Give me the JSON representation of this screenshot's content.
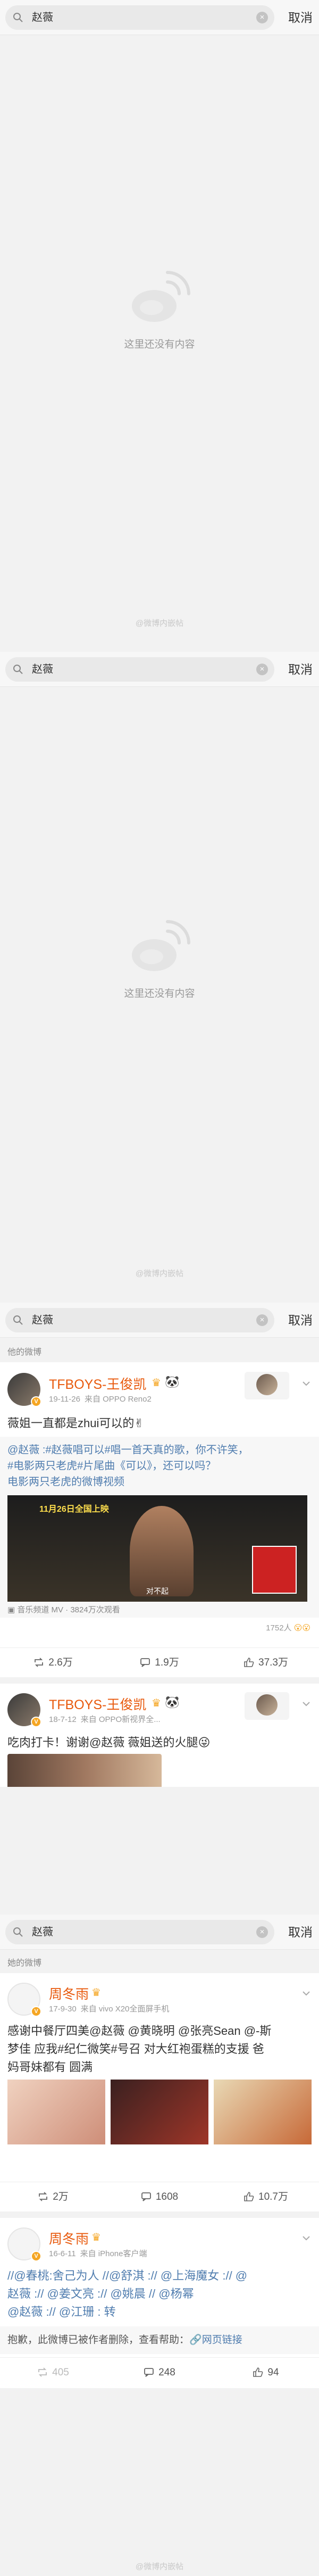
{
  "search": {
    "query": "赵薇",
    "cancel_label": "取消"
  },
  "empty": {
    "message": "这里还没有内容"
  },
  "watermark": "@微博内嵌帖",
  "section_title": "他的微博",
  "section_title_2": "她的微博",
  "posts": [
    {
      "user": "TFBOYS-王俊凯",
      "time": "19-11-26",
      "source": "来自 OPPO Reno2",
      "text_prefix": "薇姐一直都是zhui可以的",
      "text_lines": [
        "@赵薇 :#赵薇唱可以#唱一首天真的歌，你不许笑，",
        "#电影两只老虎#片尾曲《可以》，还可以吗？",
        "电影两只老虎的微博视频"
      ],
      "video_caption": "音乐频道 MV · 3824万次观看",
      "video_overlay": "11月26日全国上映",
      "video_subtitle": "对不起",
      "reactions": "1752人",
      "stats": {
        "repost": "2.6万",
        "comment": "1.9万",
        "like": "37.3万"
      }
    },
    {
      "user": "TFBOYS-王俊凯",
      "time": "18-7-12",
      "source": "来自 OPPO新视界全...",
      "text": "吃肉打卡！谢谢@赵薇 薇姐送的火腿",
      "stats": {}
    },
    {
      "user": "周冬雨",
      "time": "17-9-30",
      "source": "来自 vivo X20全面屏手机",
      "text_lines": [
        "感谢中餐厅四美@赵薇 @黄晓明 @张亮Sean @-斯",
        "梦佳 应我#纪仁微笑#号召 对大红袍蛋糕的支援 爸",
        "妈哥妹都有 圆满"
      ],
      "stats": {
        "repost": "2万",
        "comment": "1608",
        "like": "10.7万"
      }
    },
    {
      "user": "周冬雨",
      "time": "16-6-11",
      "source": "来自 iPhone客户端",
      "text_lines": [
        "//@春桃:舍己为人 //@舒淇 :// @上海魔女 :// @",
        "赵薇 :// @姜文亮 :// @姚晨 // @杨幂",
        "@赵薇 :// @江珊 : 转"
      ],
      "notice": "抱歉，此微博已被作者删除，查看帮助：",
      "notice_link": "网页链接",
      "stats": {
        "repost": "405",
        "comment": "248",
        "like": "94"
      }
    }
  ],
  "colors": {
    "username": "#e8590c",
    "link": "#507daf",
    "vip": "#f5a623"
  }
}
